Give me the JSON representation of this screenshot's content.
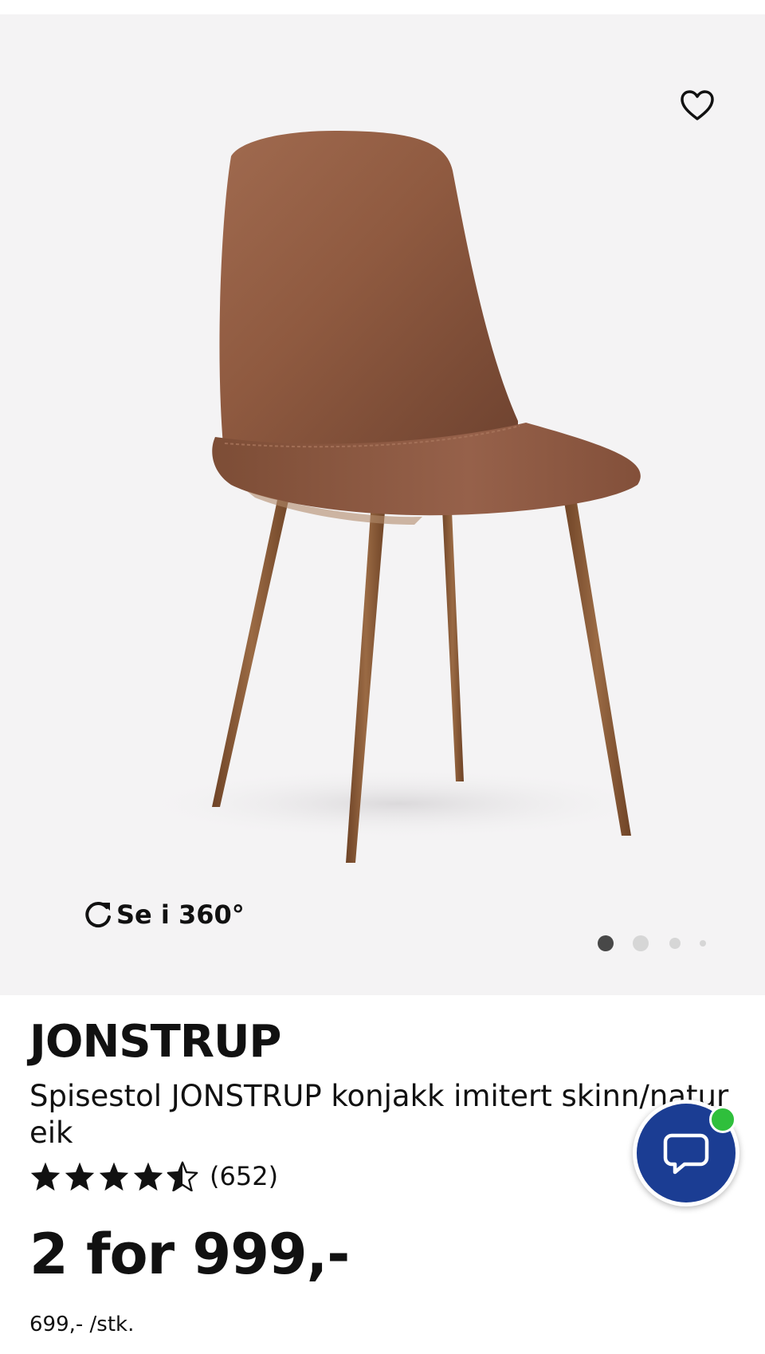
{
  "gallery": {
    "view_360_label": "Se i 360°",
    "favorite_icon": "heart-outline-icon",
    "rotate_icon": "rotate-icon",
    "dots_count": 4,
    "active_dot": 0,
    "background_color": "#f4f3f4"
  },
  "product": {
    "name": "JONSTRUP",
    "description": "Spisestol JONSTRUP konjakk imitert skinn/natur eik",
    "rating": {
      "value": 4.5,
      "max": 5,
      "count_label": "(652)"
    },
    "price_label": "2 for 999,-",
    "unit_price_label": "699,- /stk."
  },
  "chat": {
    "icon": "chat-bubble-icon",
    "status_color": "#2fbf3c",
    "brand_color": "#1b3d93"
  }
}
